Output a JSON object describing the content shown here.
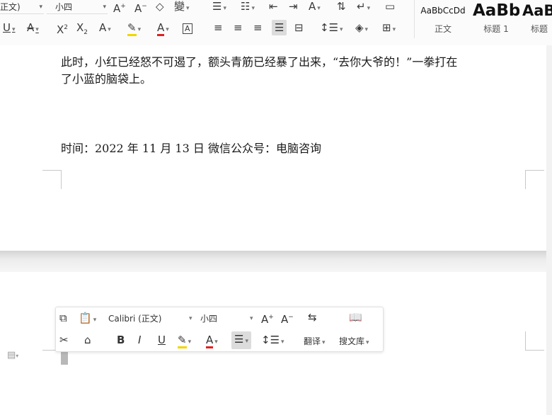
{
  "ribbon": {
    "font_name": "正文)",
    "font_size": "小四",
    "style_items": [
      {
        "preview": "AaBbCcDd",
        "name": "正文"
      },
      {
        "preview": "AaBb",
        "name": "标题 1"
      },
      {
        "preview": "AaB",
        "name": "标题"
      }
    ]
  },
  "document": {
    "para1_line1": "此时，小红已经怒不可遏了，额头青筋已经暴了出来，“去你大爷的！”一拳打在",
    "para1_line2": "了小蓝的脑袋上。",
    "footer_line": "时间：2022 年 11 月 13 日  微信公众号：电脑咨询"
  },
  "mini_toolbar": {
    "font_name": "Calibri (正文)",
    "font_size": "小四",
    "translate_label": "翻译",
    "search_library_label": "搜文库"
  },
  "colors": {
    "accent_yellow": "#f2d600",
    "font_red": "#e02020"
  }
}
